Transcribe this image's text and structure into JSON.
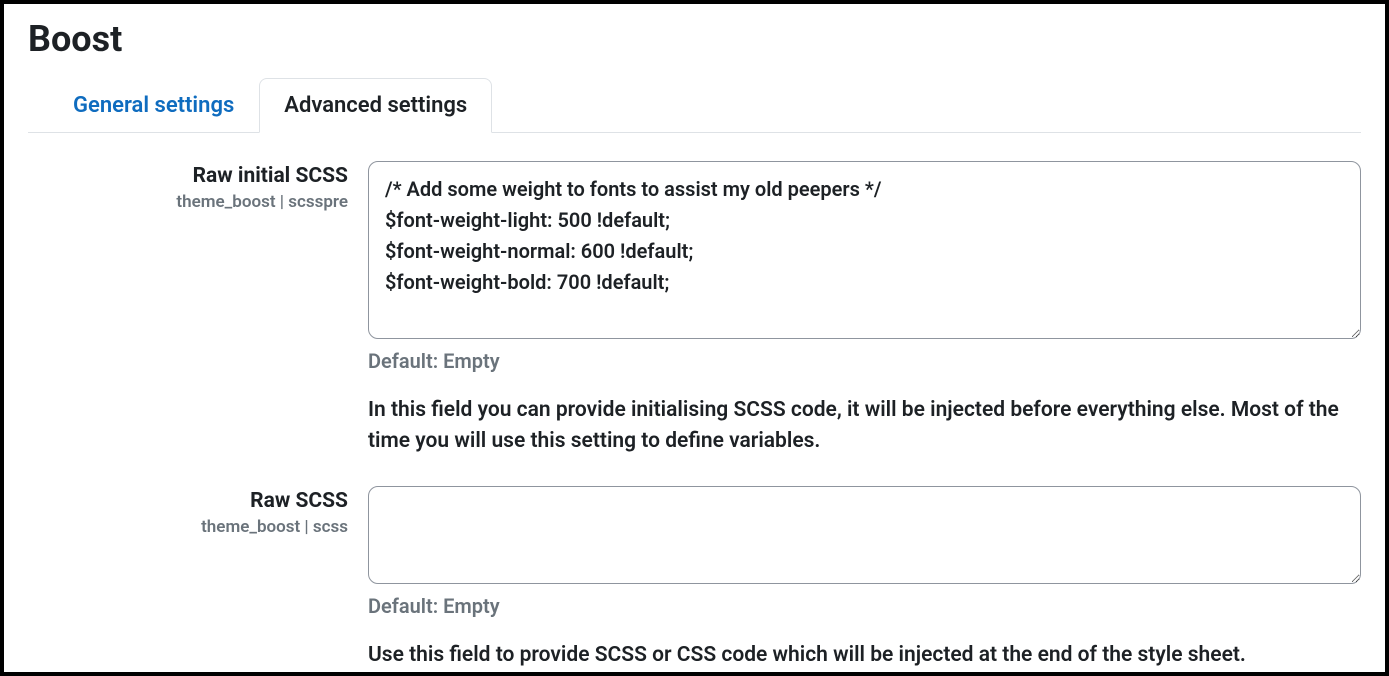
{
  "header": {
    "title": "Boost"
  },
  "tabs": {
    "general": {
      "label": "General settings",
      "active": false
    },
    "advanced": {
      "label": "Advanced settings",
      "active": true
    }
  },
  "fields": {
    "scsspre": {
      "label": "Raw initial SCSS",
      "sublabel": "theme_boost | scsspre",
      "value": "/* Add some weight to fonts to assist my old peepers */\n$font-weight-light: 500 !default;\n$font-weight-normal: 600 !default;\n$font-weight-bold: 700 !default;",
      "default_text": "Default: Empty",
      "description": "In this field you can provide initialising SCSS code, it will be injected before everything else. Most of the time you will use this setting to define variables."
    },
    "scss": {
      "label": "Raw SCSS",
      "sublabel": "theme_boost | scss",
      "value": "",
      "default_text": "Default: Empty",
      "description": "Use this field to provide SCSS or CSS code which will be injected at the end of the style sheet."
    }
  }
}
